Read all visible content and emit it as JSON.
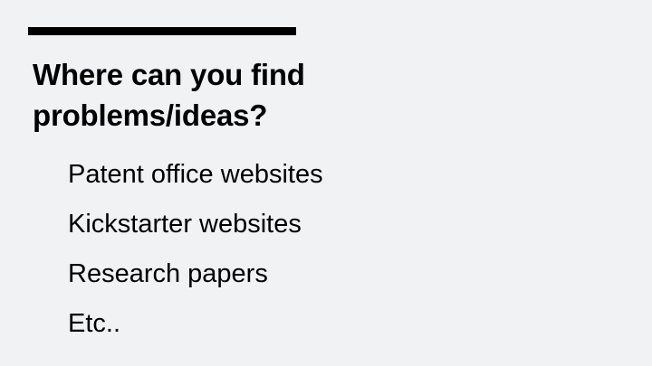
{
  "slide": {
    "title_line1": "Where can you find",
    "title_line2": "problems/ideas?",
    "bullets": [
      "Patent office websites",
      "Kickstarter websites",
      "Research papers",
      "Etc.."
    ]
  },
  "colors": {
    "background": "#f1f2f4",
    "text": "#000000",
    "accent_bar": "#000000"
  }
}
